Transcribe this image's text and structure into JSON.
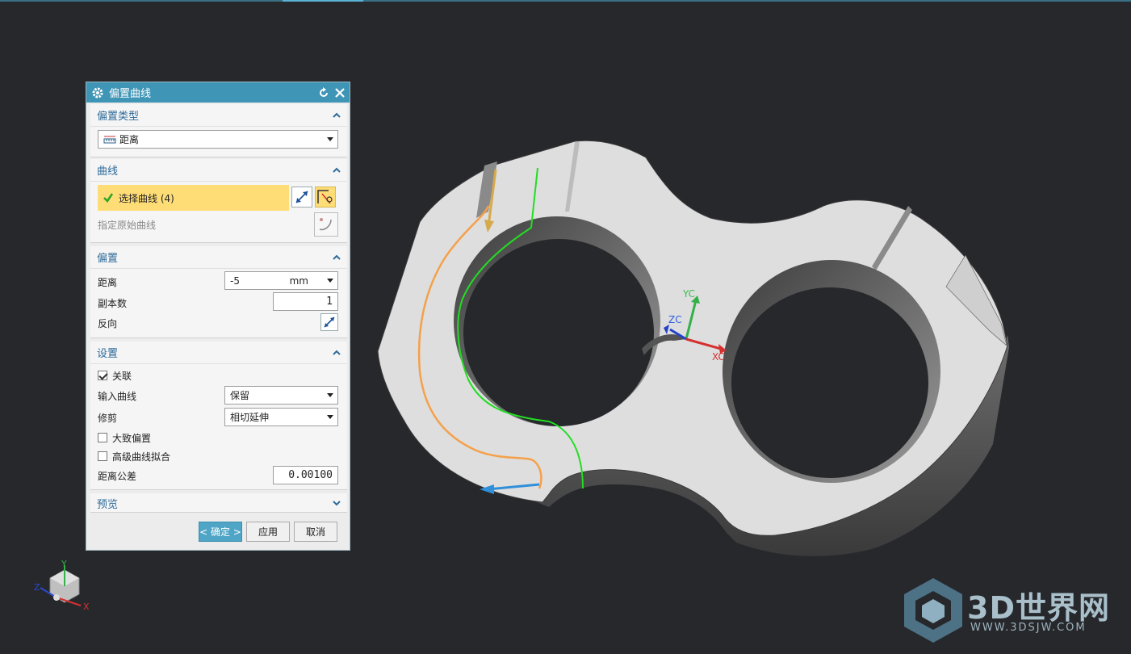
{
  "dialog": {
    "title": "偏置曲线",
    "offset_type": {
      "header": "偏置类型",
      "value": "距离"
    },
    "curve": {
      "header": "曲线",
      "select_label": "选择曲线 (4)",
      "specify_original_label": "指定原始曲线"
    },
    "offset": {
      "header": "偏置",
      "distance_label": "距离",
      "distance_value": "-5",
      "distance_unit": "mm",
      "copies_label": "副本数",
      "copies_value": "1",
      "reverse_label": "反向"
    },
    "settings": {
      "header": "设置",
      "associative_label": "关联",
      "associative_checked": true,
      "input_curve_label": "输入曲线",
      "input_curve_value": "保留",
      "trim_label": "修剪",
      "trim_value": "相切延伸",
      "rough_offset_label": "大致偏置",
      "rough_offset_checked": false,
      "advanced_fit_label": "高级曲线拟合",
      "advanced_fit_checked": false,
      "tolerance_label": "距离公差",
      "tolerance_value": "0.00100"
    },
    "preview": {
      "header": "预览"
    },
    "buttons": {
      "ok": "< 确定 >",
      "apply": "应用",
      "cancel": "取消"
    }
  },
  "viewport": {
    "csys_labels": {
      "yc": "YC",
      "zc": "ZC",
      "xc": "XC"
    },
    "triad_labels": {
      "x": "X",
      "y": "Y",
      "z": "Z"
    },
    "watermark_text": "3D世界网",
    "watermark_url": "WWW.3DSJW.COM"
  },
  "colors": {
    "background": "#26282c",
    "dialog_title": "#3f95b6",
    "selection_highlight": "#fedd76",
    "part_face": "#dcdcdc",
    "offset_curve": "#22dd22",
    "selected_curve": "#f5a04a"
  }
}
